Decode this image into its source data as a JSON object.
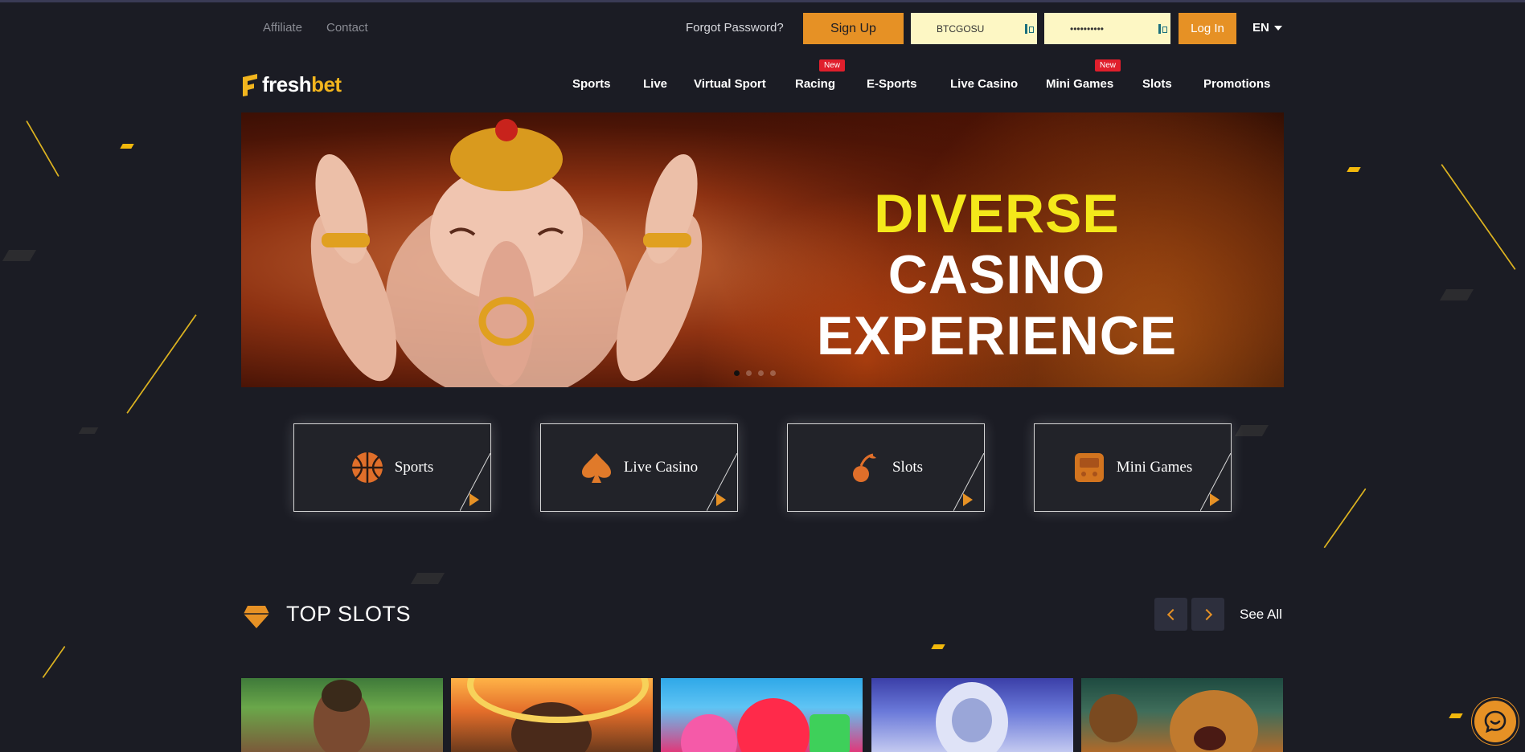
{
  "topbar": {
    "links": [
      "Affiliate",
      "Contact"
    ],
    "forgot_password": "Forgot Password?",
    "signup_label": "Sign Up",
    "username_value": "BTCGOSU",
    "password_value": "••••••••••",
    "login_label": "Log In",
    "language": "EN"
  },
  "logo": {
    "fresh": "fresh",
    "bet": "bet"
  },
  "nav": {
    "items": [
      "Sports",
      "Live",
      "Virtual Sport",
      "Racing",
      "E-Sports",
      "Live Casino",
      "Mini Games",
      "Slots",
      "Promotions"
    ],
    "new_badge": "New"
  },
  "banner": {
    "line1_highlight": "DIVERSE",
    "line1_rest": "CASINO",
    "line2": "EXPERIENCE",
    "slide_count": 4,
    "active_slide": 1
  },
  "categories": [
    {
      "label": "Sports",
      "icon": "basketball-icon"
    },
    {
      "label": "Live Casino",
      "icon": "spade-icon"
    },
    {
      "label": "Slots",
      "icon": "cherry-icon"
    },
    {
      "label": "Mini Games",
      "icon": "arcade-icon"
    }
  ],
  "top_slots": {
    "title": "TOP SLOTS",
    "see_all": "See All",
    "games": [
      "slot-game-1",
      "slot-game-2",
      "slot-game-3",
      "slot-game-4",
      "slot-game-5"
    ]
  },
  "colors": {
    "accent": "#e69125",
    "background": "#1b1c24",
    "badge": "#e01f2c",
    "banner_highlight": "#f4e81a"
  }
}
